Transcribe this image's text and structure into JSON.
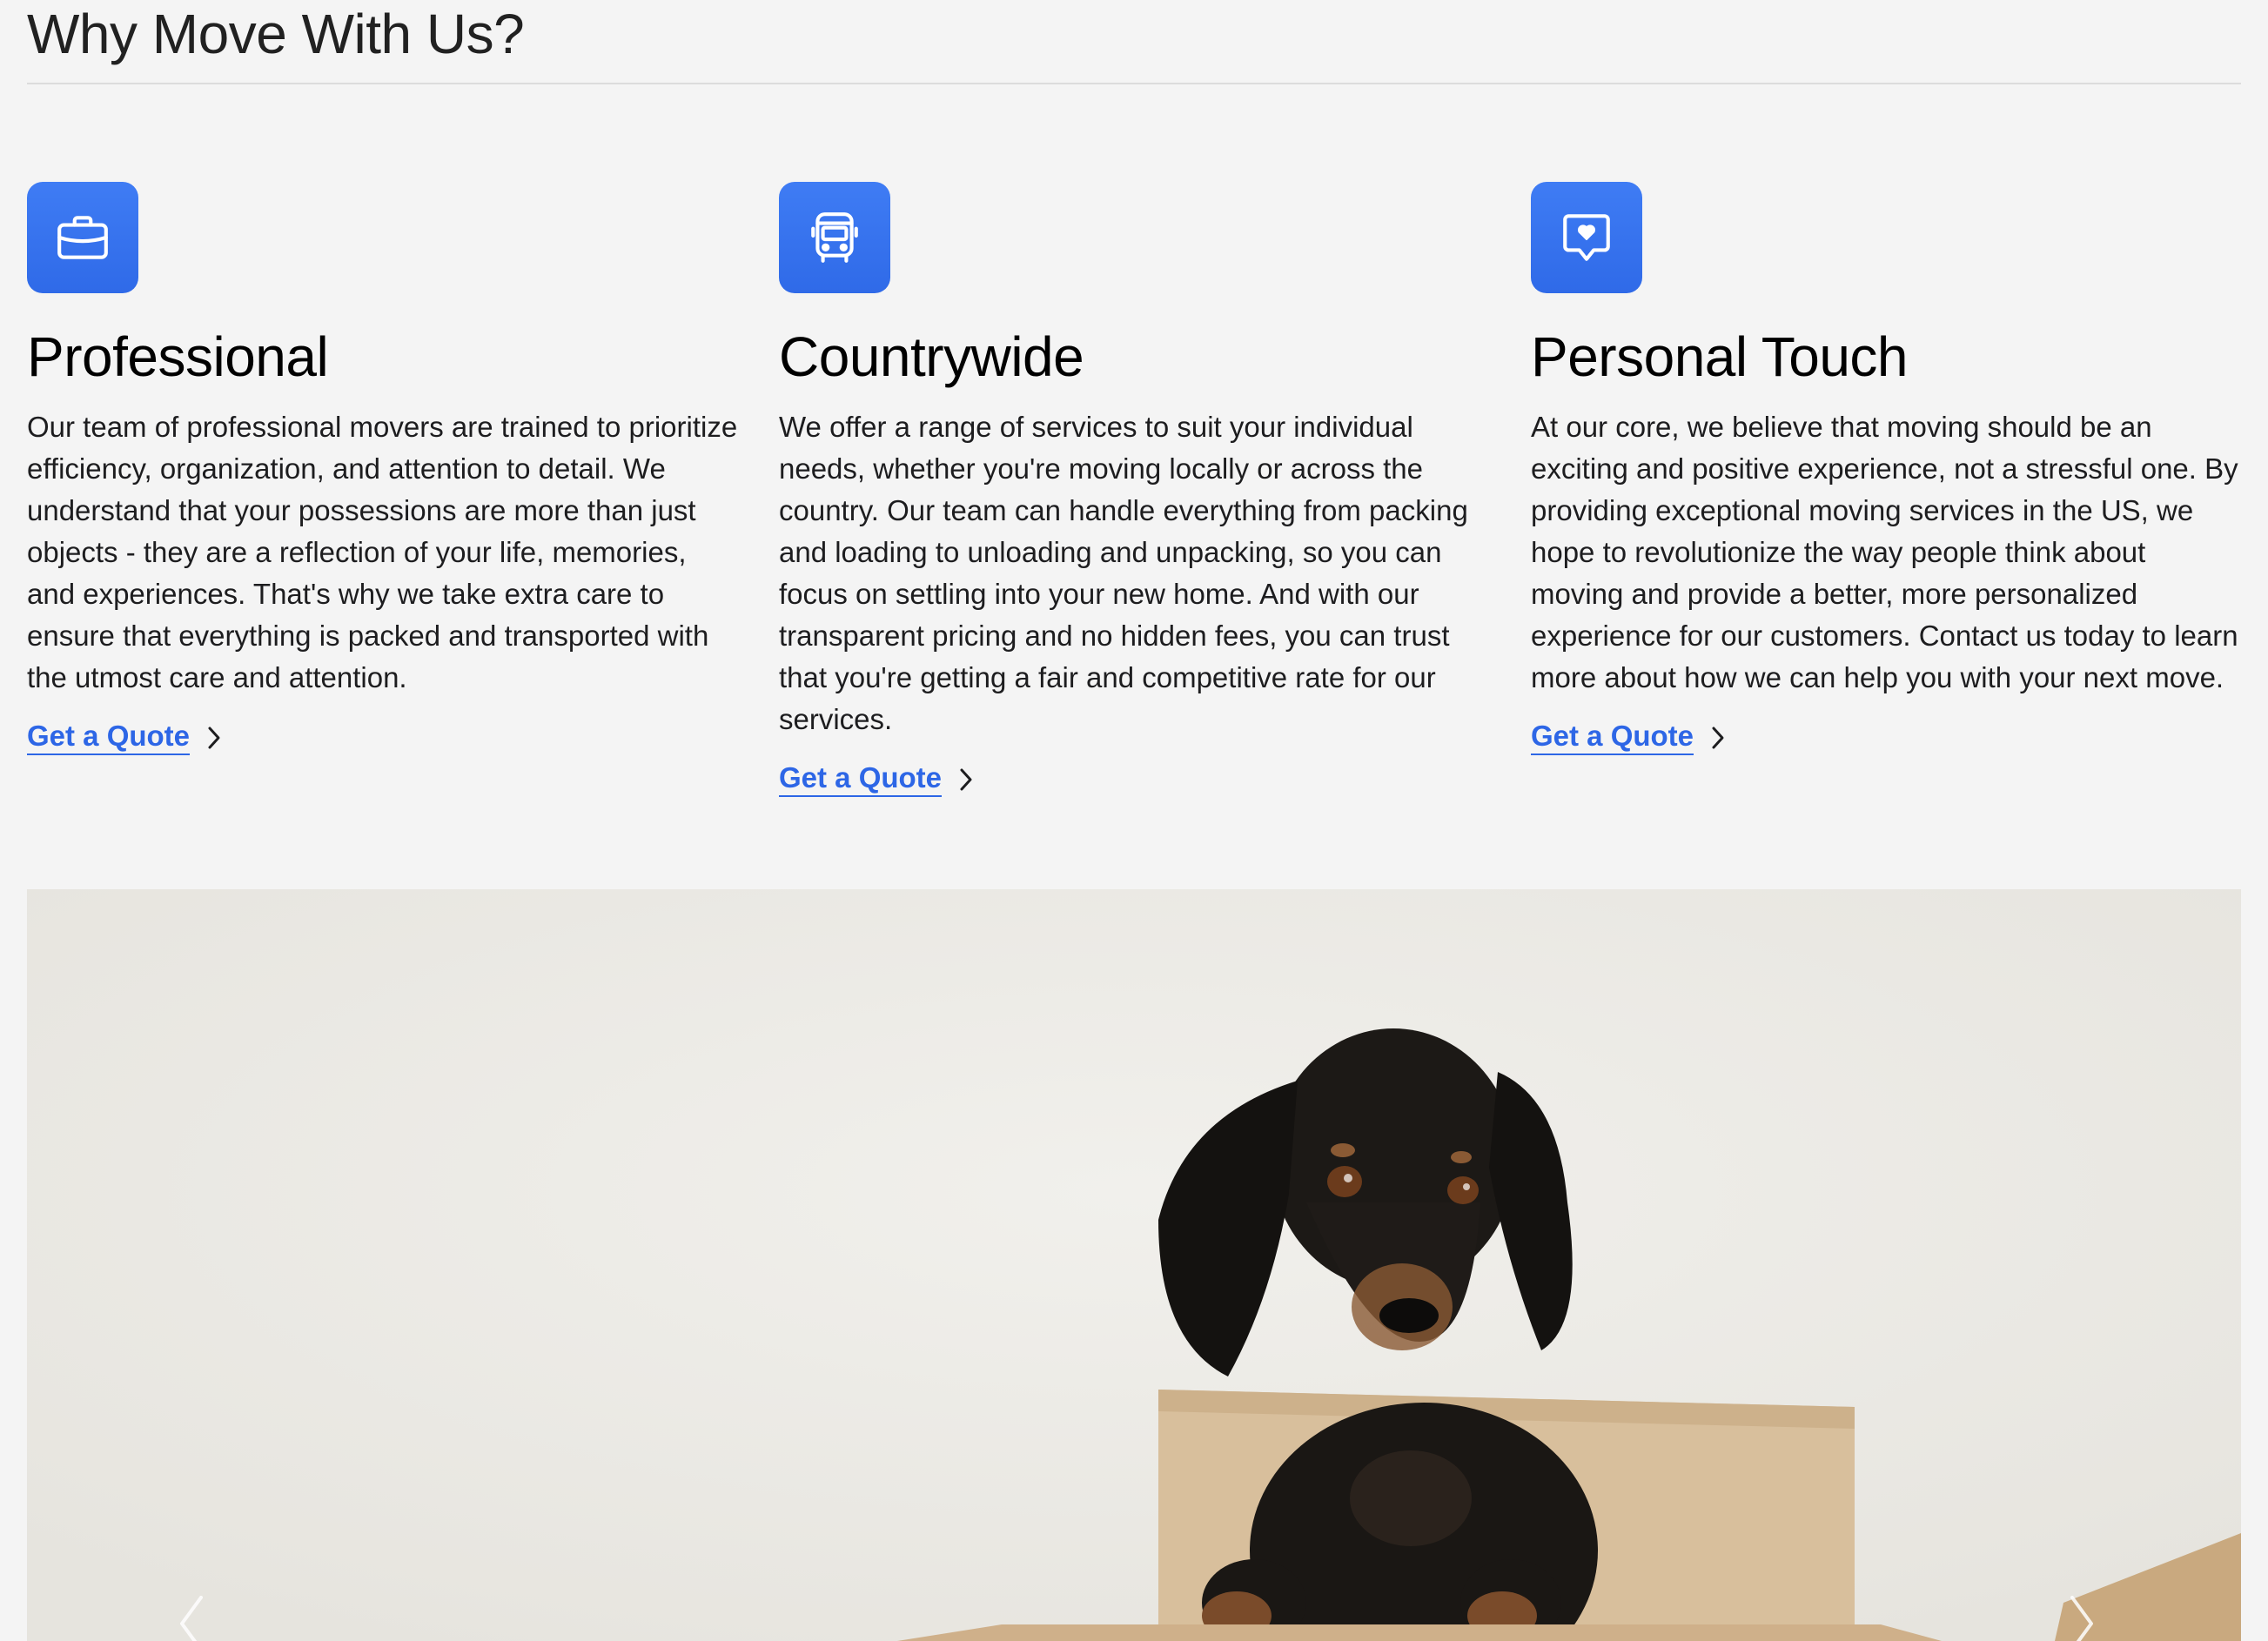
{
  "section": {
    "title": "Why Move With Us?"
  },
  "features": [
    {
      "icon": "briefcase-icon",
      "title": "Professional",
      "body": "Our team of professional movers are trained to prioritize efficiency, organization, and attention to detail. We understand that your possessions are more than just objects - they are a reflection of your life, memories, and experiences. That's why we take extra care to ensure that everything is packed and transported with the utmost care and attention.",
      "link": "Get a Quote"
    },
    {
      "icon": "bus-icon",
      "title": "Countrywide",
      "body": "We offer a range of services to suit your individual needs, whether you're moving locally or across the country. Our team can handle everything from packing and loading to unloading and unpacking, so you can focus on settling into your new home. And with our transparent pricing and no hidden fees, you can trust that you're getting a fair and competitive rate for our services.",
      "link": "Get a Quote"
    },
    {
      "icon": "heart-message-icon",
      "title": "Personal Touch",
      "body": "At our core, we believe that moving should be an exciting and positive experience, not a stressful one. By providing exceptional moving services in the US, we hope to revolutionize the way people think about moving and provide a better, more personalized experience for our customers. Contact us today to learn more about how we can help you with your next move.",
      "link": "Get a Quote"
    }
  ],
  "carousel": {
    "image": "dachshund-in-cardboard-box",
    "prev_icon": "chevron-left-icon",
    "next_icon": "chevron-right-icon"
  },
  "colors": {
    "accent": "#2d66e6",
    "background": "#f4f4f4"
  }
}
